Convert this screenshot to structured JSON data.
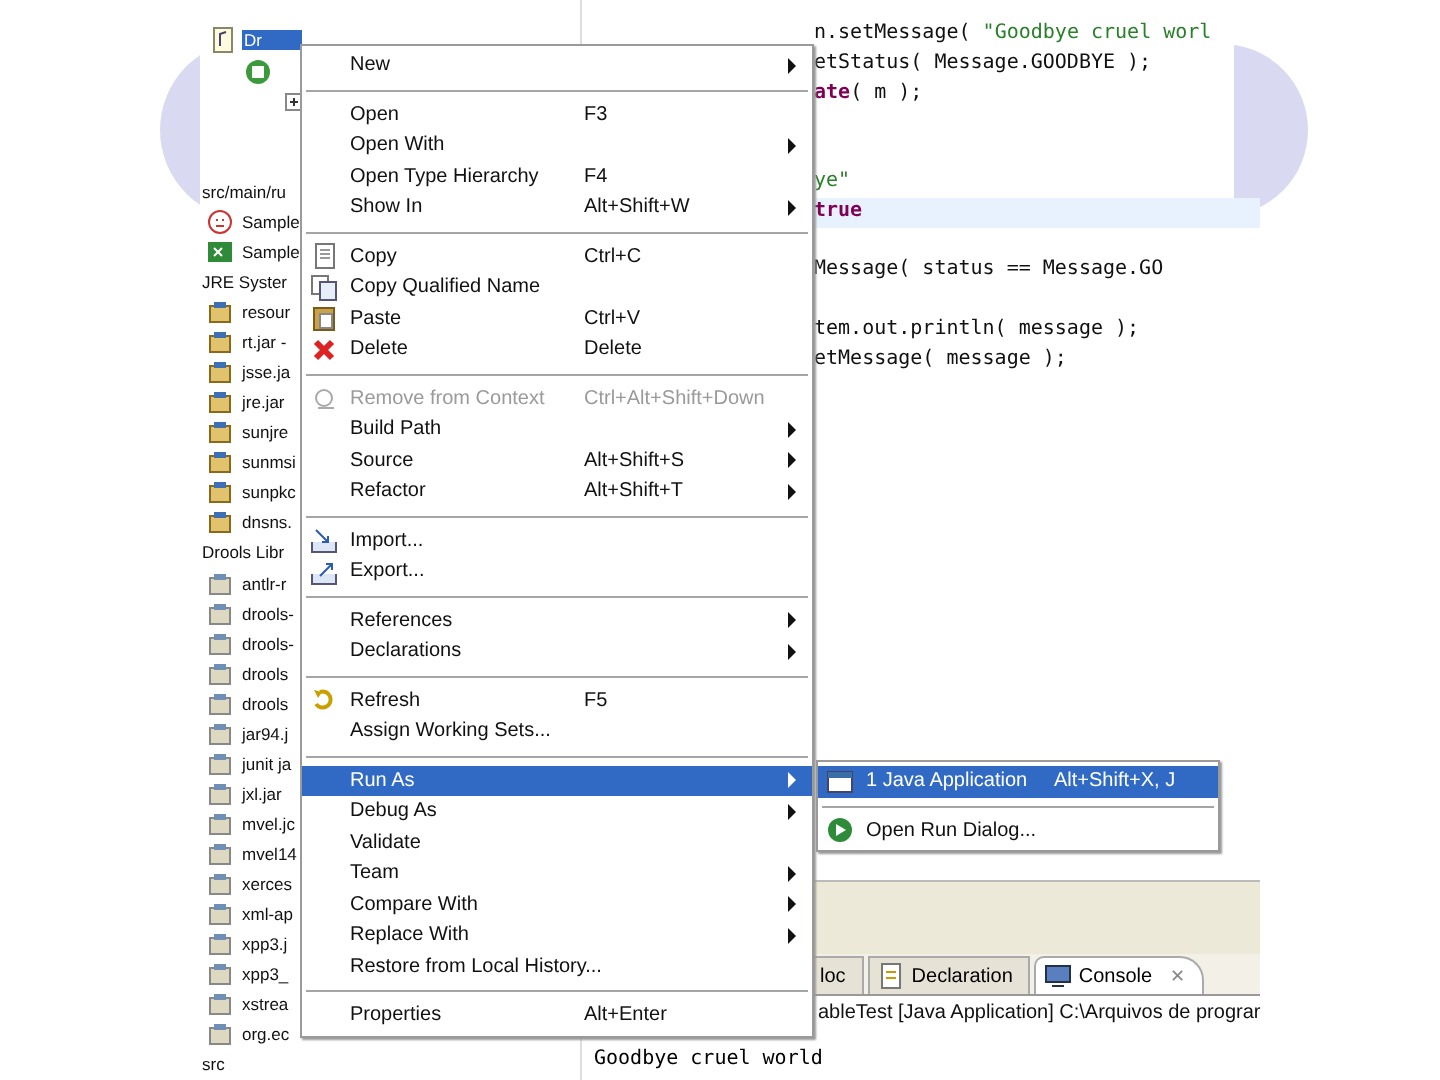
{
  "explorer": {
    "top_items": [
      {
        "kind": "project",
        "label": "Dr",
        "selected": true
      },
      {
        "kind": "source-project",
        "selected": false
      },
      {
        "kind": "expander",
        "selected": false
      }
    ],
    "items": [
      {
        "kind": "text",
        "label": "src/main/ru"
      },
      {
        "kind": "drools",
        "label": "Sample"
      },
      {
        "kind": "sheet",
        "label": "Sample"
      },
      {
        "kind": "text",
        "label": "JRE Syster"
      },
      {
        "kind": "jar",
        "label": "resour"
      },
      {
        "kind": "jar",
        "label": "rt.jar -"
      },
      {
        "kind": "jar",
        "label": "jsse.ja"
      },
      {
        "kind": "jar",
        "label": "jre.jar"
      },
      {
        "kind": "jar",
        "label": "sunjre"
      },
      {
        "kind": "jar",
        "label": "sunmsi"
      },
      {
        "kind": "jar",
        "label": "sunpkc"
      },
      {
        "kind": "jar",
        "label": "dnsns."
      },
      {
        "kind": "text",
        "label": "Drools Libr"
      },
      {
        "kind": "lib",
        "label": "antlr-r"
      },
      {
        "kind": "lib",
        "label": "drools-"
      },
      {
        "kind": "lib",
        "label": "drools-"
      },
      {
        "kind": "lib",
        "label": "drools"
      },
      {
        "kind": "lib",
        "label": "drools"
      },
      {
        "kind": "lib",
        "label": "jar94.j"
      },
      {
        "kind": "lib",
        "label": "junit ja"
      },
      {
        "kind": "lib",
        "label": "jxl.jar"
      },
      {
        "kind": "lib",
        "label": "mvel.jc"
      },
      {
        "kind": "lib",
        "label": "mvel14"
      },
      {
        "kind": "lib",
        "label": "xerces"
      },
      {
        "kind": "lib",
        "label": "xml-ap"
      },
      {
        "kind": "lib",
        "label": "xpp3.j"
      },
      {
        "kind": "lib",
        "label": "xpp3_"
      },
      {
        "kind": "lib",
        "label": "xstrea"
      },
      {
        "kind": "lib",
        "label": "org.ec"
      },
      {
        "kind": "text",
        "label": "src"
      }
    ]
  },
  "editor": {
    "blocks": [
      [
        {
          "current": false,
          "segments": [
            {
              "kind": "plain",
              "text": "n.setMessage( "
            },
            {
              "kind": "string",
              "text": "\"Goodbye cruel worl"
            }
          ]
        },
        {
          "current": false,
          "segments": [
            {
              "kind": "plain",
              "text": "etStatus( Message.GOODBYE );"
            }
          ]
        },
        {
          "current": false,
          "segments": [
            {
              "kind": "keyword",
              "text": "ate"
            },
            {
              "kind": "plain",
              "text": "( m );"
            }
          ]
        }
      ],
      [
        {
          "current": false,
          "segments": [
            {
              "kind": "string",
              "text": "ye\""
            }
          ]
        },
        {
          "current": true,
          "segments": [
            {
              "kind": "keyword",
              "text": "true"
            }
          ]
        }
      ],
      [
        {
          "current": false,
          "segments": [
            {
              "kind": "plain",
              "text": "Message( status == Message.GO"
            }
          ]
        }
      ],
      [
        {
          "current": false,
          "segments": [
            {
              "kind": "plain",
              "text": "tem.out.println( message );"
            }
          ]
        },
        {
          "current": false,
          "segments": [
            {
              "kind": "plain",
              "text": "etMessage( message );"
            }
          ]
        }
      ]
    ]
  },
  "console": {
    "tabs": [
      {
        "label": "loc",
        "selected": false
      },
      {
        "label": "Declaration",
        "selected": false
      },
      {
        "label": "Console",
        "selected": true,
        "close": "✕"
      }
    ],
    "title": "ableTest [Java Application] C:\\Arquivos de prograr",
    "output": "Goodbye cruel world"
  },
  "context_menu": {
    "groups": [
      [
        {
          "label": "New",
          "submenu": true,
          "disabled": false,
          "selected": false
        }
      ],
      [
        {
          "label": "Open",
          "shortcut": "F3",
          "submenu": false,
          "disabled": false,
          "selected": false
        },
        {
          "label": "Open With",
          "submenu": true,
          "disabled": false,
          "selected": false
        },
        {
          "label": "Open Type Hierarchy",
          "shortcut": "F4",
          "submenu": false,
          "disabled": false,
          "selected": false
        },
        {
          "label": "Show In",
          "shortcut": "Alt+Shift+W",
          "submenu": true,
          "disabled": false,
          "selected": false
        }
      ],
      [
        {
          "label": "Copy",
          "shortcut": "Ctrl+C",
          "submenu": false,
          "disabled": false,
          "selected": false
        },
        {
          "label": "Copy Qualified Name",
          "submenu": false,
          "disabled": false,
          "selected": false
        },
        {
          "label": "Paste",
          "shortcut": "Ctrl+V",
          "submenu": false,
          "disabled": false,
          "selected": false
        },
        {
          "label": "Delete",
          "shortcut": "Delete",
          "submenu": false,
          "disabled": false,
          "selected": false
        }
      ],
      [
        {
          "label": "Remove from Context",
          "shortcut": "Ctrl+Alt+Shift+Down",
          "submenu": false,
          "disabled": true,
          "selected": false
        },
        {
          "label": "Build Path",
          "submenu": true,
          "disabled": false,
          "selected": false
        },
        {
          "label": "Source",
          "shortcut": "Alt+Shift+S",
          "submenu": true,
          "disabled": false,
          "selected": false
        },
        {
          "label": "Refactor",
          "shortcut": "Alt+Shift+T",
          "submenu": true,
          "disabled": false,
          "selected": false
        }
      ],
      [
        {
          "label": "Import...",
          "submenu": false,
          "disabled": false,
          "selected": false
        },
        {
          "label": "Export...",
          "submenu": false,
          "disabled": false,
          "selected": false
        }
      ],
      [
        {
          "label": "References",
          "submenu": true,
          "disabled": false,
          "selected": false
        },
        {
          "label": "Declarations",
          "submenu": true,
          "disabled": false,
          "selected": false
        }
      ],
      [
        {
          "label": "Refresh",
          "shortcut": "F5",
          "submenu": false,
          "disabled": false,
          "selected": false
        },
        {
          "label": "Assign Working Sets...",
          "submenu": false,
          "disabled": false,
          "selected": false
        }
      ],
      [
        {
          "label": "Run As",
          "submenu": true,
          "disabled": false,
          "selected": true
        },
        {
          "label": "Debug As",
          "submenu": true,
          "disabled": false,
          "selected": false
        },
        {
          "label": "Validate",
          "submenu": false,
          "disabled": false,
          "selected": false
        },
        {
          "label": "Team",
          "submenu": true,
          "disabled": false,
          "selected": false
        },
        {
          "label": "Compare With",
          "submenu": true,
          "disabled": false,
          "selected": false
        },
        {
          "label": "Replace With",
          "submenu": true,
          "disabled": false,
          "selected": false
        },
        {
          "label": "Restore from Local History...",
          "submenu": false,
          "disabled": false,
          "selected": false
        }
      ],
      [
        {
          "label": "Properties",
          "shortcut": "Alt+Enter",
          "submenu": false,
          "disabled": false,
          "selected": false
        }
      ]
    ]
  },
  "submenu": {
    "groups": [
      [
        {
          "label": "1 Java Application",
          "shortcut": "Alt+Shift+X, J",
          "selected": true
        }
      ],
      [
        {
          "label": "Open Run Dialog...",
          "selected": false
        }
      ]
    ]
  }
}
